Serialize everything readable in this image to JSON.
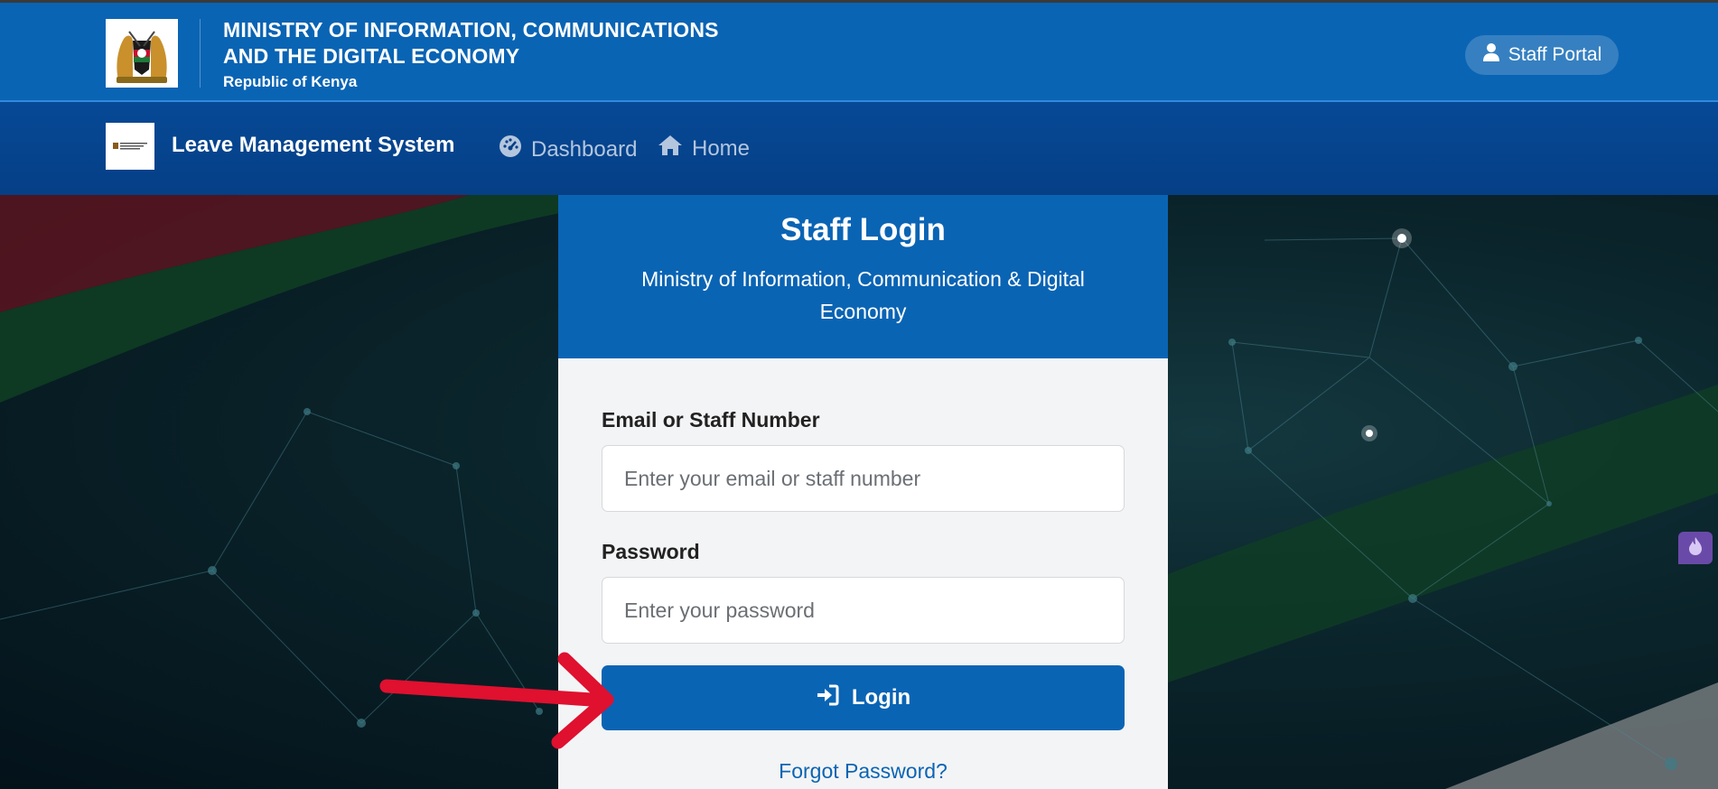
{
  "header": {
    "ministry_line1": "MINISTRY OF INFORMATION, COMMUNICATIONS",
    "ministry_line2": "AND THE DIGITAL ECONOMY",
    "subtitle": "Republic of Kenya",
    "staff_portal_label": "Staff Portal"
  },
  "nav": {
    "app_title": "Leave Management System",
    "dashboard_label": "Dashboard",
    "home_label": "Home"
  },
  "login_card": {
    "title": "Staff Login",
    "subtitle": "Ministry of Information, Communication & Digital Economy",
    "email_label": "Email or Staff Number",
    "email_placeholder": "Enter your email or staff number",
    "password_label": "Password",
    "password_placeholder": "Enter your password",
    "login_button": "Login",
    "forgot_password": "Forgot Password?"
  },
  "colors": {
    "primary": "#0a64b4",
    "nav_bg": "#053f86",
    "annotation_arrow": "#e0102f",
    "widget": "#6a4aa8"
  }
}
